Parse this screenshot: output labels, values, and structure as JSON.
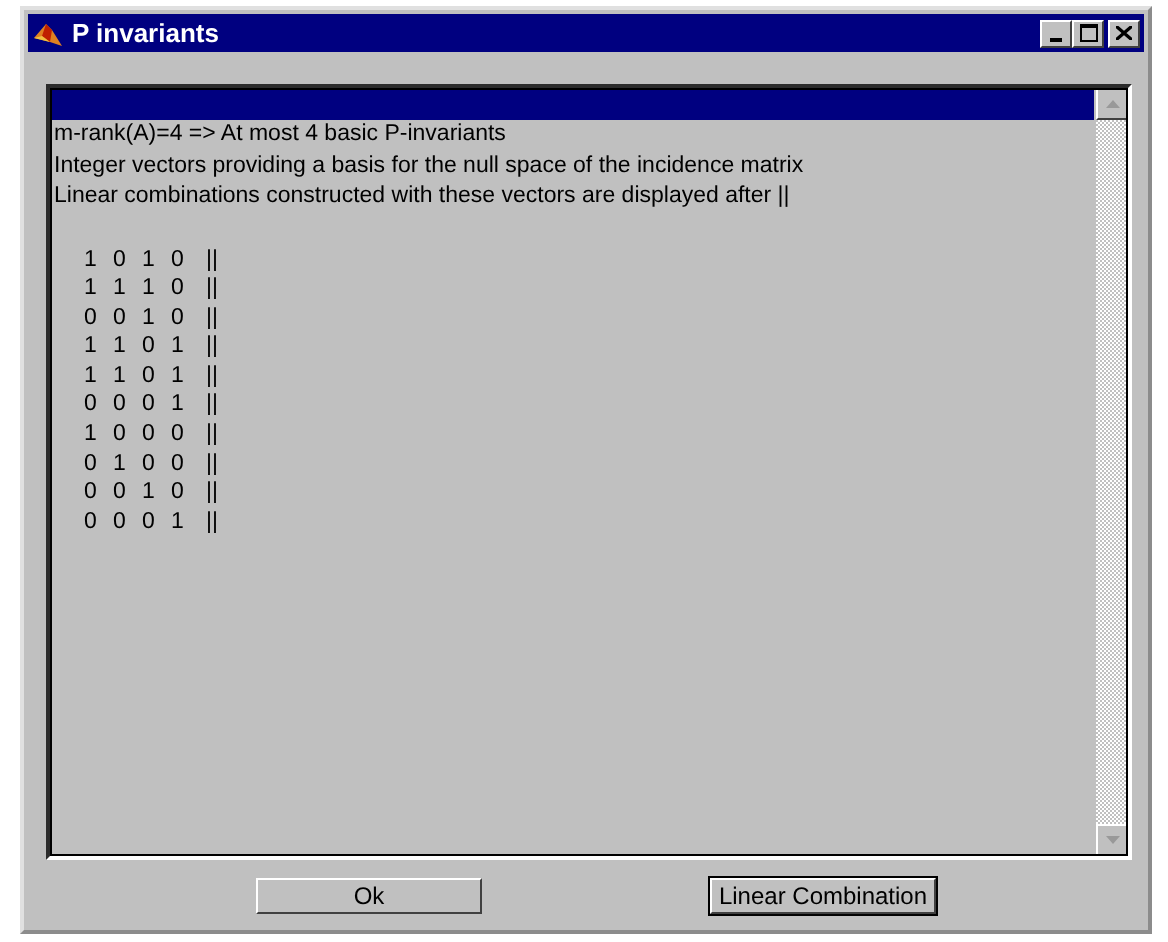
{
  "window": {
    "title": "P invariants"
  },
  "list": {
    "highlight_row": {
      "selected": true
    },
    "lines": [
      "m-rank(A)=4 => At most 4 basic P-invariants",
      "Integer vectors providing a basis for the null space of the incidence matrix",
      "Linear combinations constructed with these vectors are displayed after ||"
    ],
    "matrix": [
      {
        "values": [
          "1",
          "0",
          "1",
          "0"
        ],
        "separator": "||"
      },
      {
        "values": [
          "1",
          "1",
          "1",
          "0"
        ],
        "separator": "||"
      },
      {
        "values": [
          "0",
          "0",
          "1",
          "0"
        ],
        "separator": "||"
      },
      {
        "values": [
          "1",
          "1",
          "0",
          "1"
        ],
        "separator": "||"
      },
      {
        "values": [
          "1",
          "1",
          "0",
          "1"
        ],
        "separator": "||"
      },
      {
        "values": [
          "0",
          "0",
          "0",
          "1"
        ],
        "separator": "||"
      },
      {
        "values": [
          "1",
          "0",
          "0",
          "0"
        ],
        "separator": "||"
      },
      {
        "values": [
          "0",
          "1",
          "0",
          "0"
        ],
        "separator": "||"
      },
      {
        "values": [
          "0",
          "0",
          "1",
          "0"
        ],
        "separator": "||"
      },
      {
        "values": [
          "0",
          "0",
          "0",
          "1"
        ],
        "separator": "||"
      }
    ]
  },
  "buttons": [
    "Ok",
    "Linear Combination"
  ]
}
